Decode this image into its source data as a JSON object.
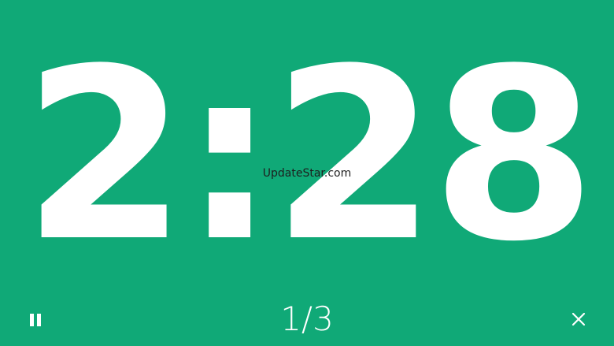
{
  "timer": {
    "time_remaining": "2:28"
  },
  "watermark": {
    "text": "UpdateStar.com"
  },
  "progress": {
    "label": "1/3"
  },
  "controls": {
    "pause_icon": "pause-icon",
    "close_icon": "close-icon"
  },
  "colors": {
    "background": "#10a977",
    "foreground": "#ffffff"
  }
}
